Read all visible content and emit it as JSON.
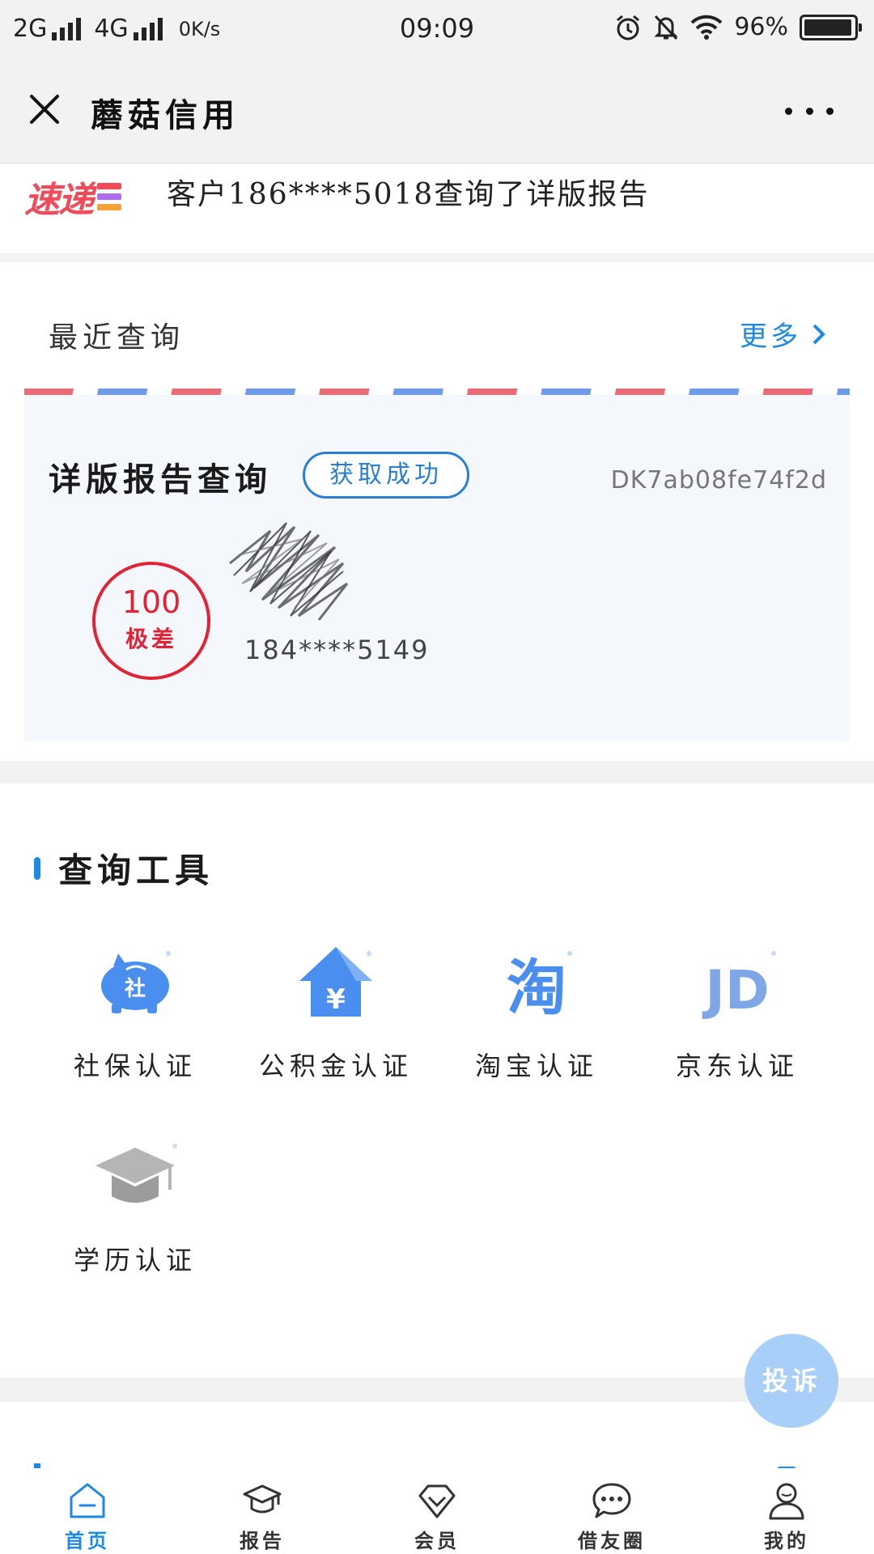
{
  "status_bar": {
    "network1": "2G",
    "network2": "4G",
    "speed": "0K/s",
    "time": "09:09",
    "battery": "96%",
    "battery_level": 0.96
  },
  "header": {
    "title": "蘑菇信用",
    "close_icon": "close-icon",
    "more_icon": "more-icon"
  },
  "ticker": {
    "logo_text": "速递",
    "logo_colors": [
      "#ef4b5a",
      "#b06cf0",
      "#f6a23a"
    ],
    "message": "客户186****5018查询了详版报告"
  },
  "recent": {
    "title": "最近查询",
    "more_label": "更多",
    "card": {
      "report_name": "详版报告查询",
      "status": "获取成功",
      "report_id": "DK7ab08fe74f2d",
      "score": "100",
      "score_level": "极差",
      "phone": "184****5149"
    }
  },
  "tools": {
    "title": "查询工具",
    "items": [
      {
        "label": "社保认证",
        "icon": "piggy-bank-icon",
        "glyph": "社"
      },
      {
        "label": "公积金认证",
        "icon": "house-fund-icon",
        "glyph": "¥"
      },
      {
        "label": "淘宝认证",
        "icon": "taobao-icon",
        "glyph": "淘"
      },
      {
        "label": "京东认证",
        "icon": "jd-icon",
        "glyph": "JD"
      },
      {
        "label": "学历认证",
        "icon": "graduation-cap-icon",
        "glyph": ""
      }
    ]
  },
  "complaint_label": "投诉",
  "tabbar": {
    "items": [
      {
        "label": "首页",
        "icon": "home-icon",
        "active": true
      },
      {
        "label": "报告",
        "icon": "graduation-cap-icon",
        "active": false
      },
      {
        "label": "会员",
        "icon": "diamond-icon",
        "active": false
      },
      {
        "label": "借友圈",
        "icon": "chat-bubble-icon",
        "active": false
      },
      {
        "label": "我的",
        "icon": "user-icon",
        "active": false
      }
    ]
  },
  "colors": {
    "accent": "#1e88e5",
    "stamp_red": "#e02436",
    "badge_blue": "#2a7fd4",
    "icon_blue": "#4a8ff0",
    "icon_grey": "#b5b5b5"
  }
}
